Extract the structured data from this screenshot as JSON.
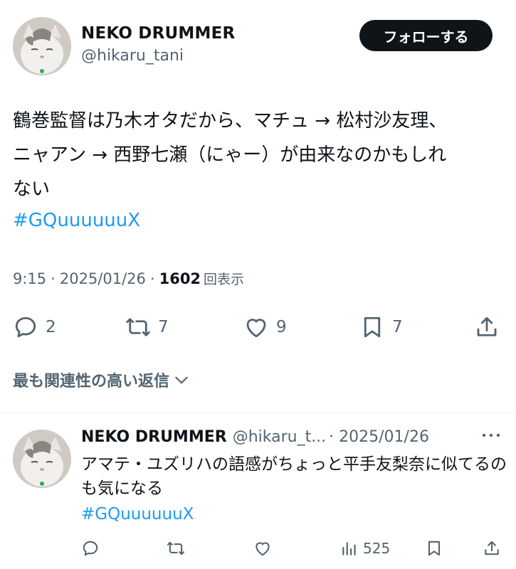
{
  "main": {
    "name": "NEKO DRUMMER",
    "handle": "@hikaru_tani",
    "follow_label": "フォローする",
    "text": "鶴巻監督は乃木オタだから、マチュ → 松村沙友理、\nニャアン → 西野七瀬（にゃー）が由来なのかもしれ\nない",
    "hashtag": "#GQuuuuuuX",
    "time": "9:15",
    "date": "2025/01/26",
    "views": "1602",
    "views_label": "回表示",
    "sep": "·",
    "replies": "2",
    "reposts": "7",
    "likes": "9",
    "bookmarks": "7"
  },
  "relevant_label": "最も関連性の高い返信",
  "reply": {
    "name": "NEKO DRUMMER",
    "handle": "@hikaru_t...",
    "date": "· 2025/01/26",
    "text": "アマテ・ユズリハの語感がちょっと平手友梨奈に似てるのも気になる",
    "hashtag": "#GQuuuuuuX",
    "views": "525"
  },
  "colors": {
    "text": "#0f1419",
    "secondary": "#536471",
    "link": "#1d9bf0",
    "button_bg": "#0f1419"
  }
}
